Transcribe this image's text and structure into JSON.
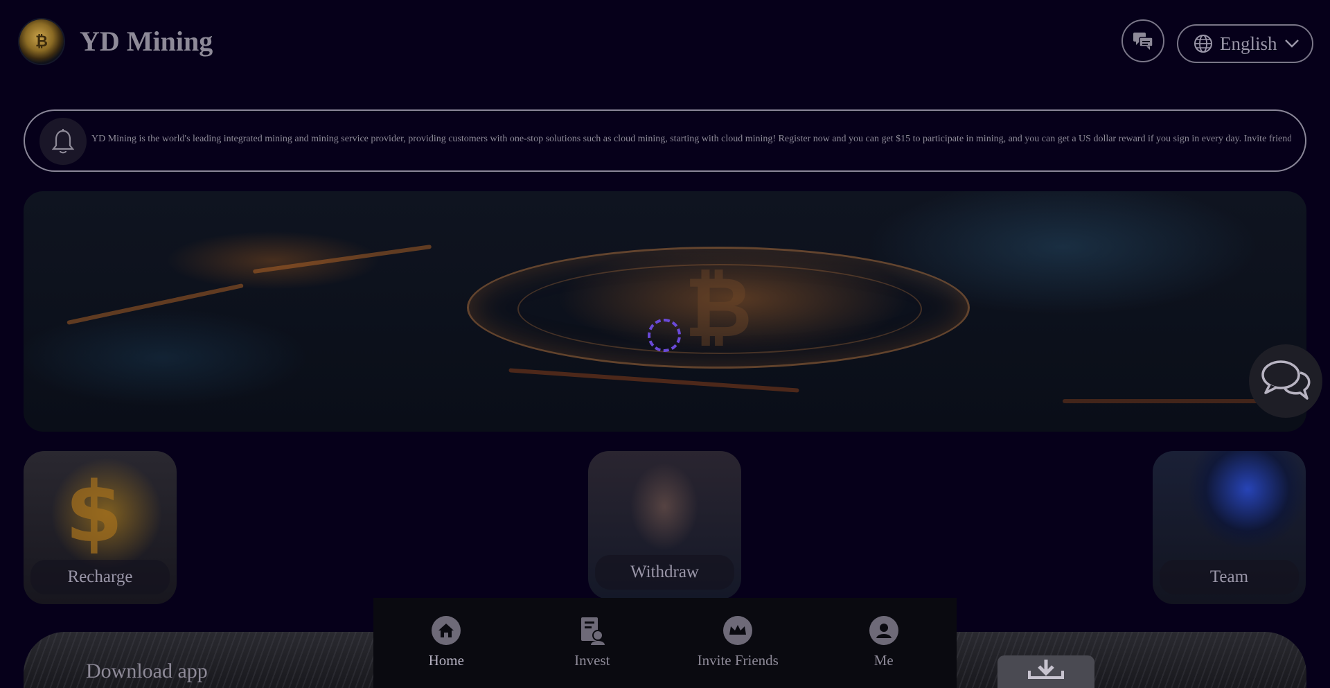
{
  "header": {
    "title": "YD Mining",
    "logo_icon": "bitcoin-logo-icon",
    "support_icon": "chat-bubbles-icon",
    "language": {
      "icon": "globe-icon",
      "selected": "English",
      "chevron": "chevron-down-icon"
    }
  },
  "notice": {
    "icon": "bell-icon",
    "text": "YD Mining is the world's leading integrated mining and mining service provider, providing customers with one-stop solutions such as cloud mining, starting with cloud mining! Register now and you can get $15 to participate in mining, and you can get a US dollar reward if you sign in every day. Invite friend"
  },
  "banner": {
    "loading_icon": "loading-spinner-icon",
    "floating_chat_icon": "chat-bubbles-icon"
  },
  "quick_actions": [
    {
      "label": "Recharge"
    },
    {
      "label": "Withdraw"
    },
    {
      "label": "Team"
    }
  ],
  "download": {
    "label": "Download app",
    "icon": "download-icon"
  },
  "bottom_nav": [
    {
      "label": "Home",
      "icon": "home-icon",
      "active": true
    },
    {
      "label": "Invest",
      "icon": "invest-icon",
      "active": false
    },
    {
      "label": "Invite Friends",
      "icon": "crown-icon",
      "active": false
    },
    {
      "label": "Me",
      "icon": "user-icon",
      "active": false
    }
  ]
}
